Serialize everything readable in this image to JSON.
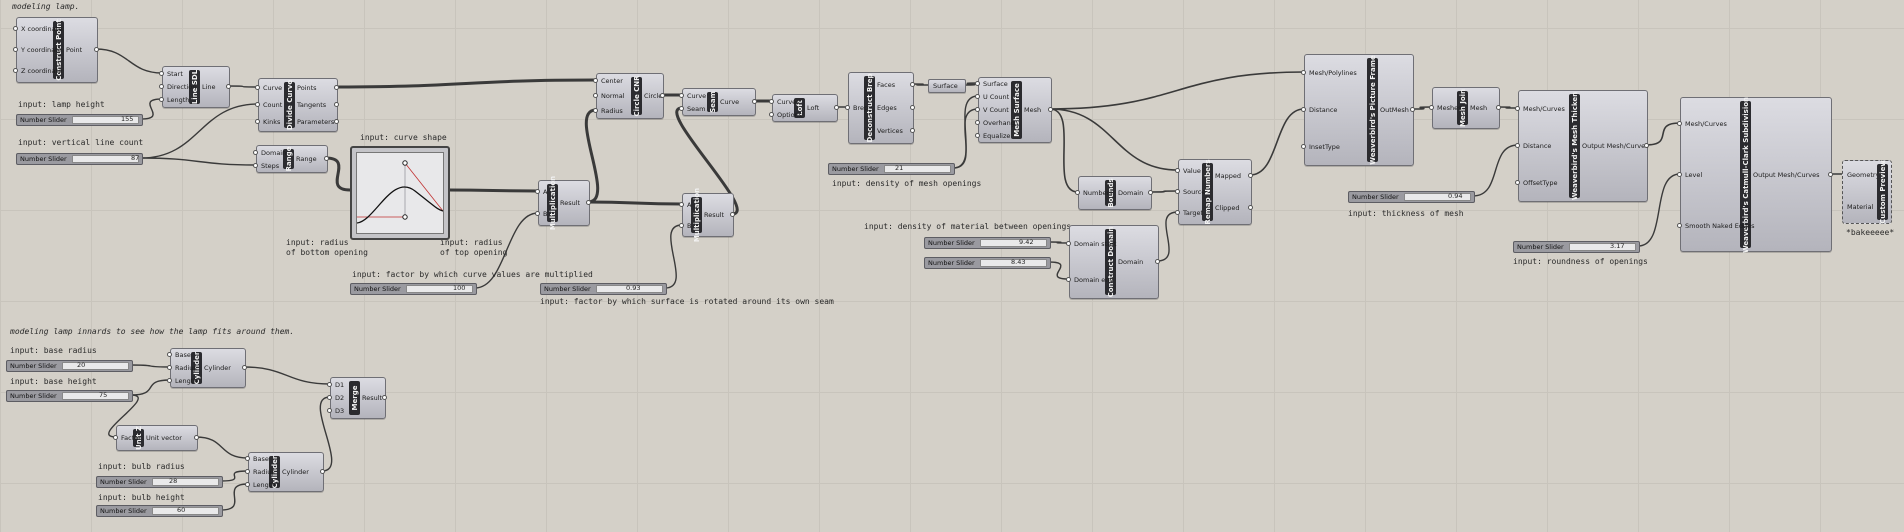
{
  "notes": {
    "modeling_lamp": "modeling lamp.",
    "lamp_height": "input: lamp height",
    "vertical_line_count": "input: vertical line count",
    "curve_shape": "input: curve shape",
    "radius_bottom": "input: radius\nof bottom opening",
    "radius_top": "input: radius\nof top opening",
    "factor_multiplied": "input: factor by which curve values are multiplied",
    "factor_rotated": "input: factor by which surface is rotated around its own seam",
    "density_mesh": "input: density of mesh openings",
    "density_material": "input: density of material between openings",
    "thickness_mesh": "input: thickness of mesh",
    "roundness_openings": "input: roundness of openings",
    "bakeeeee": "*bakeeeee*",
    "modeling_innards": "modeling lamp innards to see how the lamp fits around them.",
    "base_radius": "input: base radius",
    "base_height": "input: base height",
    "bulb_radius": "input: bulb radius",
    "bulb_height": "input: bulb height"
  },
  "slider_label": "Number Slider",
  "sliders": {
    "lamp_height": "155",
    "line_count": "87",
    "mesh_density": "21",
    "factor": "100",
    "rotation": "0.93",
    "domain_start": "9.42",
    "domain_end": "8.43",
    "thickness": "0.94",
    "roundness": "3.17",
    "base_radius": "20",
    "base_height": "75",
    "bulb_radius": "28",
    "bulb_height": "60"
  },
  "components": {
    "construct_point": {
      "title": "Construct Point",
      "in": [
        "X coordinate",
        "Y coordinate",
        "Z coordinate"
      ],
      "out": [
        "Point"
      ]
    },
    "line_sdl": {
      "title": "Line SDL",
      "in": [
        "Start",
        "Direction",
        "Length"
      ],
      "out": [
        "Line"
      ]
    },
    "divide_curve": {
      "title": "Divide Curve",
      "in": [
        "Curve",
        "Count",
        "Kinks"
      ],
      "out": [
        "Points",
        "Tangents",
        "Parameters"
      ]
    },
    "range": {
      "title": "Range",
      "in": [
        "Domain",
        "Steps"
      ],
      "out": [
        "Range"
      ]
    },
    "multiplication1": {
      "title": "Multiplication",
      "in": [
        "A",
        "B"
      ],
      "out": [
        "Result"
      ]
    },
    "circle_cnr": {
      "title": "Circle CNR",
      "in": [
        "Center",
        "Normal",
        "Radius"
      ],
      "out": [
        "Circle"
      ]
    },
    "seam": {
      "title": "Seam",
      "in": [
        "Curve",
        "Seam"
      ],
      "out": [
        "Curve"
      ]
    },
    "multiplication2": {
      "title": "Multiplication",
      "in": [
        "A",
        "B"
      ],
      "out": [
        "Result"
      ]
    },
    "loft": {
      "title": "Loft",
      "in": [
        "Curves",
        "Options"
      ],
      "out": [
        "Loft"
      ]
    },
    "deconstruct_brep": {
      "title": "Deconstruct Brep",
      "in": [
        "Brep"
      ],
      "out": [
        "Faces",
        "Edges",
        "Vertices"
      ]
    },
    "surface_param": {
      "label": "Surface"
    },
    "mesh_surface": {
      "title": "Mesh Surface",
      "in": [
        "Surface",
        "U Count",
        "V Count",
        "Overhang",
        "Equalize"
      ],
      "out": [
        "Mesh"
      ]
    },
    "bounds": {
      "title": "Bounds",
      "in": [
        "Numbers"
      ],
      "out": [
        "Domain"
      ]
    },
    "construct_domain": {
      "title": "Construct Domain",
      "in": [
        "Domain start",
        "Domain end"
      ],
      "out": [
        "Domain"
      ]
    },
    "remap_numbers": {
      "title": "Remap Numbers",
      "in": [
        "Value",
        "Source",
        "Target"
      ],
      "out": [
        "Mapped",
        "Clipped"
      ]
    },
    "picture_frame": {
      "title": "Weaverbird's Picture Frame",
      "in": [
        "Mesh/Polylines",
        "Distance",
        "InsetType"
      ],
      "out": [
        "OutMesh"
      ]
    },
    "mesh_join": {
      "title": "Mesh Join",
      "in": [
        "Meshes"
      ],
      "out": [
        "Mesh"
      ]
    },
    "mesh_thicken": {
      "title": "Weaverbird's Mesh Thicken",
      "in": [
        "Mesh/Curves",
        "Distance",
        "OffsetType"
      ],
      "out": [
        "Output Mesh/Curves"
      ]
    },
    "catmull_clark": {
      "title": "Weaverbird's Catmull-Clark Subdivision",
      "in": [
        "Mesh/Curves",
        "Level",
        "Smooth Naked Edges"
      ],
      "out": [
        "Output Mesh/Curves"
      ]
    },
    "custom_preview": {
      "title": "Custom Preview",
      "in": [
        "Geometry",
        "Material"
      ]
    },
    "cylinder1": {
      "title": "Cylinder",
      "in": [
        "Base",
        "Radius",
        "Length"
      ],
      "out": [
        "Cylinder"
      ]
    },
    "unit_z": {
      "title": "Unit Z",
      "in": [
        "Factor"
      ],
      "out": [
        "Unit vector"
      ]
    },
    "cylinder2": {
      "title": "Cylinder",
      "in": [
        "Base",
        "Radius",
        "Length"
      ],
      "out": [
        "Cylinder"
      ]
    },
    "merge": {
      "title": "Merge",
      "in": [
        "D1",
        "D2",
        "D3"
      ],
      "out": [
        "Result"
      ]
    }
  },
  "colors": {
    "canvas": "#d4d0c8",
    "wire": "#3a3a3a",
    "component": "#b8b8c0",
    "title_bar": "#2b2b2f"
  }
}
